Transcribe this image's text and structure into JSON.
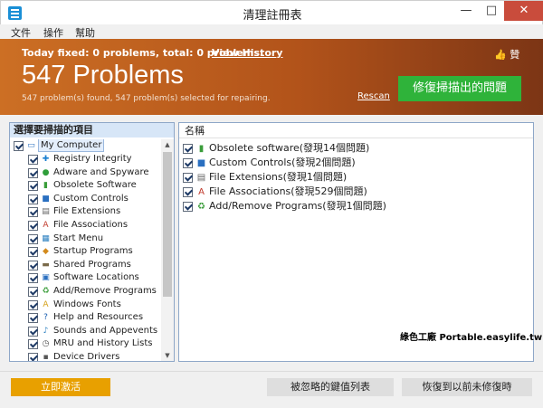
{
  "window": {
    "title": "清理註冊表",
    "min_glyph": "—",
    "max_glyph": "□",
    "close_glyph": "✕"
  },
  "menu": [
    "文件",
    "操作",
    "幫助"
  ],
  "header": {
    "today_text": "Today fixed: 0 problems, total: 0 problems.",
    "view_history": "View History",
    "like_label": "贊",
    "problems_title": "547 Problems",
    "problems_sub": "547 problem(s) found, 547 problem(s) selected for repairing.",
    "rescan": "Rescan",
    "fix_button": "修復掃描出的問題"
  },
  "left_panel": {
    "heading": "選擇要掃描的項目",
    "root": "My Computer",
    "items": [
      {
        "label": "Registry Integrity",
        "icon": "✚",
        "color": "#1a7fd0"
      },
      {
        "label": "Adware and Spyware",
        "icon": "●",
        "color": "#2f9e3a"
      },
      {
        "label": "Obsolete Software",
        "icon": "▮",
        "color": "#3a9d3a"
      },
      {
        "label": "Custom Controls",
        "icon": "■",
        "color": "#2a6fc0"
      },
      {
        "label": "File Extensions",
        "icon": "▤",
        "color": "#666666"
      },
      {
        "label": "File Associations",
        "icon": "A",
        "color": "#c0392b"
      },
      {
        "label": "Start Menu",
        "icon": "▦",
        "color": "#2a7fc0"
      },
      {
        "label": "Startup Programs",
        "icon": "◆",
        "color": "#d38a1c"
      },
      {
        "label": "Shared Programs",
        "icon": "▬",
        "color": "#7a6a4a"
      },
      {
        "label": "Software Locations",
        "icon": "▣",
        "color": "#2a6fc0"
      },
      {
        "label": "Add/Remove Programs",
        "icon": "♻",
        "color": "#3a9d3a"
      },
      {
        "label": "Windows Fonts",
        "icon": "A",
        "color": "#d4a017"
      },
      {
        "label": "Help and Resources",
        "icon": "?",
        "color": "#1a5fb0"
      },
      {
        "label": "Sounds and Appevents",
        "icon": "♪",
        "color": "#2a7fc0"
      },
      {
        "label": "MRU and History Lists",
        "icon": "◷",
        "color": "#555555"
      },
      {
        "label": "Device Drivers",
        "icon": "▪",
        "color": "#555555"
      }
    ]
  },
  "right_panel": {
    "column_header": "名稱",
    "results": [
      {
        "label": "Obsolete software(發現14個問題)",
        "icon": "▮",
        "color": "#3a9d3a"
      },
      {
        "label": "Custom Controls(發現2個問題)",
        "icon": "■",
        "color": "#2a6fc0"
      },
      {
        "label": "File Extensions(發現1個問題)",
        "icon": "▤",
        "color": "#666666"
      },
      {
        "label": "File Associations(發現529個問題)",
        "icon": "A",
        "color": "#c0392b"
      },
      {
        "label": "Add/Remove Programs(發現1個問題)",
        "icon": "♻",
        "color": "#3a9d3a"
      }
    ]
  },
  "watermark": "綠色工廠 Portable.easylife.tw",
  "footer": {
    "activate": "立即激活",
    "ignored_list": "被忽略的鍵值列表",
    "restore": "恢復到以前未修復時"
  },
  "colors": {
    "header_start": "#cc6f24",
    "header_end": "#7c3515",
    "fix_button": "#2fb33a",
    "activate_button": "#e8a000"
  }
}
